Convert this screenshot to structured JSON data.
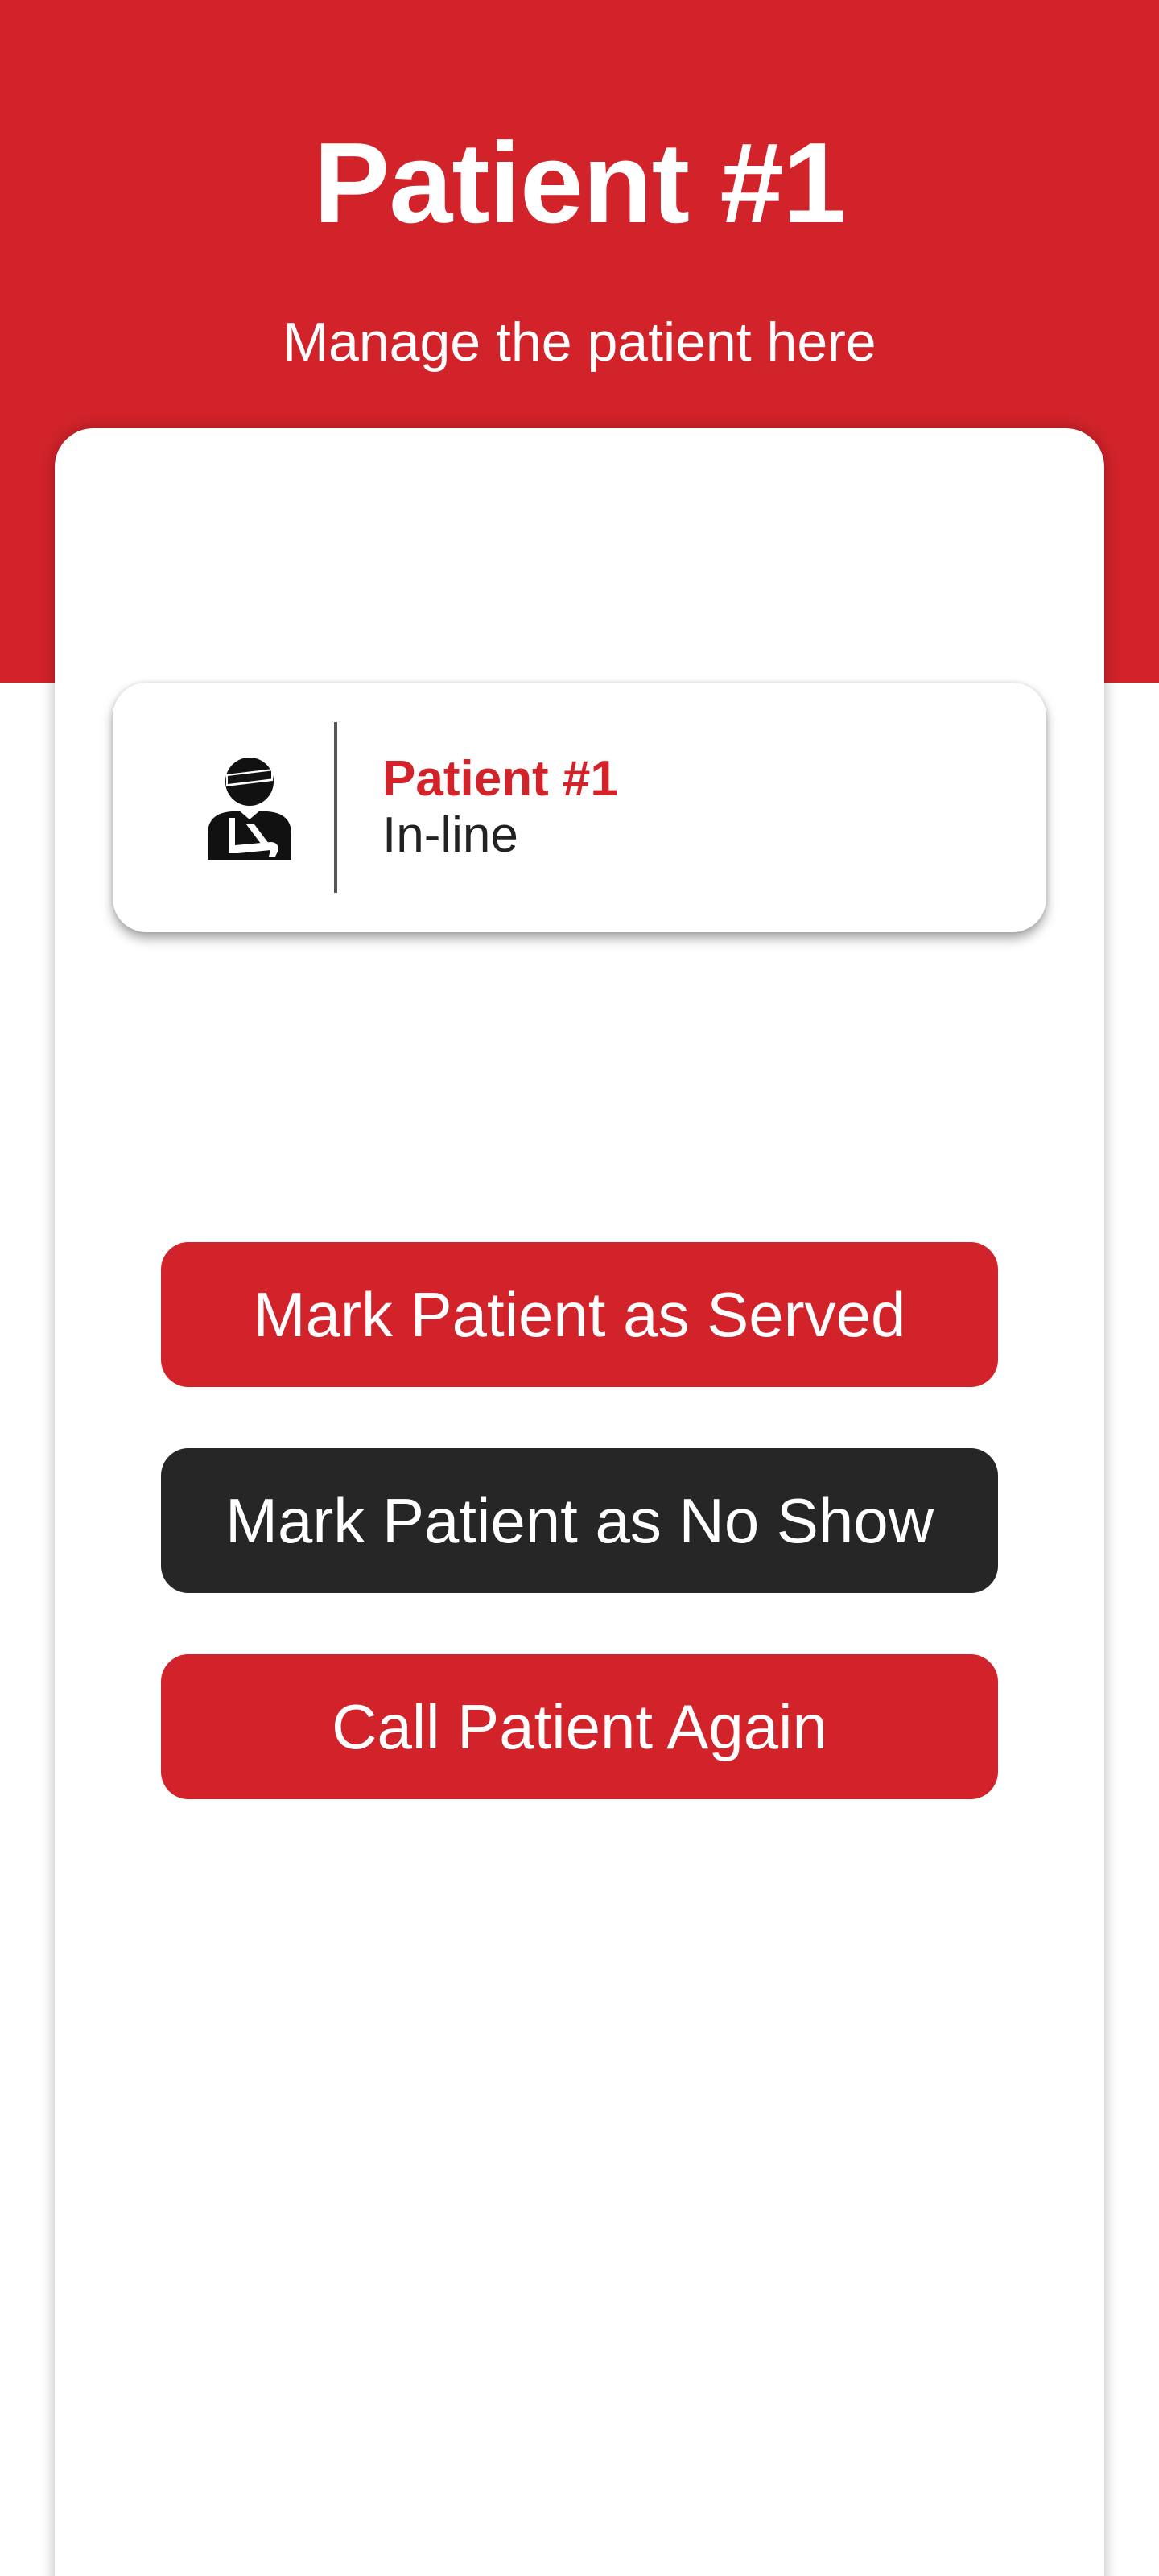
{
  "header": {
    "title": "Patient #1",
    "subtitle": "Manage the patient here"
  },
  "patient_card": {
    "icon": "injured-patient-icon",
    "name": "Patient #1",
    "status": "In-line"
  },
  "actions": {
    "served_label": "Mark Patient as Served",
    "no_show_label": "Mark Patient as No Show",
    "call_again_label": "Call Patient Again"
  },
  "colors": {
    "brand_red": "#d2232a",
    "dark_button": "#262626",
    "text_dark": "#222222",
    "background": "#ffffff"
  }
}
